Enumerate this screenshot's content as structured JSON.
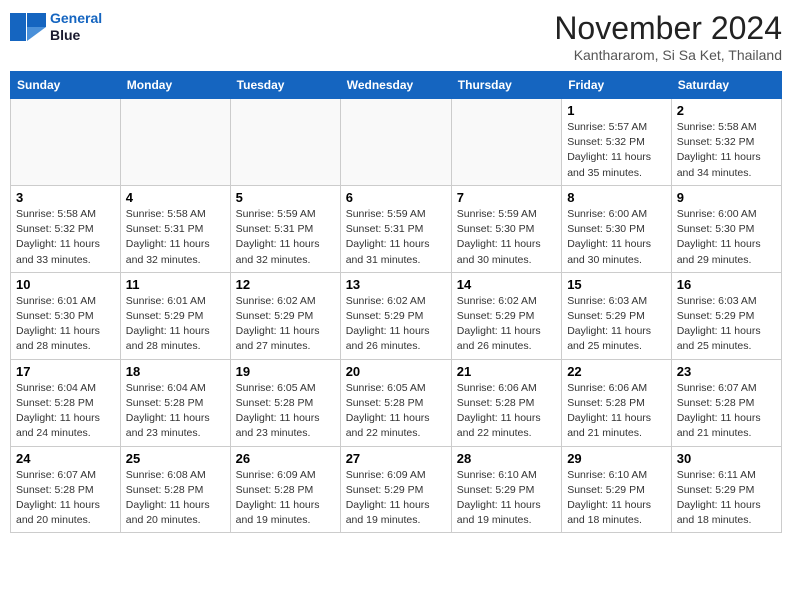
{
  "header": {
    "logo_line1": "General",
    "logo_line2": "Blue",
    "month_title": "November 2024",
    "location": "Kanthararom, Si Sa Ket, Thailand"
  },
  "weekdays": [
    "Sunday",
    "Monday",
    "Tuesday",
    "Wednesday",
    "Thursday",
    "Friday",
    "Saturday"
  ],
  "weeks": [
    [
      {
        "day": "",
        "info": ""
      },
      {
        "day": "",
        "info": ""
      },
      {
        "day": "",
        "info": ""
      },
      {
        "day": "",
        "info": ""
      },
      {
        "day": "",
        "info": ""
      },
      {
        "day": "1",
        "info": "Sunrise: 5:57 AM\nSunset: 5:32 PM\nDaylight: 11 hours and 35 minutes."
      },
      {
        "day": "2",
        "info": "Sunrise: 5:58 AM\nSunset: 5:32 PM\nDaylight: 11 hours and 34 minutes."
      }
    ],
    [
      {
        "day": "3",
        "info": "Sunrise: 5:58 AM\nSunset: 5:32 PM\nDaylight: 11 hours and 33 minutes."
      },
      {
        "day": "4",
        "info": "Sunrise: 5:58 AM\nSunset: 5:31 PM\nDaylight: 11 hours and 32 minutes."
      },
      {
        "day": "5",
        "info": "Sunrise: 5:59 AM\nSunset: 5:31 PM\nDaylight: 11 hours and 32 minutes."
      },
      {
        "day": "6",
        "info": "Sunrise: 5:59 AM\nSunset: 5:31 PM\nDaylight: 11 hours and 31 minutes."
      },
      {
        "day": "7",
        "info": "Sunrise: 5:59 AM\nSunset: 5:30 PM\nDaylight: 11 hours and 30 minutes."
      },
      {
        "day": "8",
        "info": "Sunrise: 6:00 AM\nSunset: 5:30 PM\nDaylight: 11 hours and 30 minutes."
      },
      {
        "day": "9",
        "info": "Sunrise: 6:00 AM\nSunset: 5:30 PM\nDaylight: 11 hours and 29 minutes."
      }
    ],
    [
      {
        "day": "10",
        "info": "Sunrise: 6:01 AM\nSunset: 5:30 PM\nDaylight: 11 hours and 28 minutes."
      },
      {
        "day": "11",
        "info": "Sunrise: 6:01 AM\nSunset: 5:29 PM\nDaylight: 11 hours and 28 minutes."
      },
      {
        "day": "12",
        "info": "Sunrise: 6:02 AM\nSunset: 5:29 PM\nDaylight: 11 hours and 27 minutes."
      },
      {
        "day": "13",
        "info": "Sunrise: 6:02 AM\nSunset: 5:29 PM\nDaylight: 11 hours and 26 minutes."
      },
      {
        "day": "14",
        "info": "Sunrise: 6:02 AM\nSunset: 5:29 PM\nDaylight: 11 hours and 26 minutes."
      },
      {
        "day": "15",
        "info": "Sunrise: 6:03 AM\nSunset: 5:29 PM\nDaylight: 11 hours and 25 minutes."
      },
      {
        "day": "16",
        "info": "Sunrise: 6:03 AM\nSunset: 5:29 PM\nDaylight: 11 hours and 25 minutes."
      }
    ],
    [
      {
        "day": "17",
        "info": "Sunrise: 6:04 AM\nSunset: 5:28 PM\nDaylight: 11 hours and 24 minutes."
      },
      {
        "day": "18",
        "info": "Sunrise: 6:04 AM\nSunset: 5:28 PM\nDaylight: 11 hours and 23 minutes."
      },
      {
        "day": "19",
        "info": "Sunrise: 6:05 AM\nSunset: 5:28 PM\nDaylight: 11 hours and 23 minutes."
      },
      {
        "day": "20",
        "info": "Sunrise: 6:05 AM\nSunset: 5:28 PM\nDaylight: 11 hours and 22 minutes."
      },
      {
        "day": "21",
        "info": "Sunrise: 6:06 AM\nSunset: 5:28 PM\nDaylight: 11 hours and 22 minutes."
      },
      {
        "day": "22",
        "info": "Sunrise: 6:06 AM\nSunset: 5:28 PM\nDaylight: 11 hours and 21 minutes."
      },
      {
        "day": "23",
        "info": "Sunrise: 6:07 AM\nSunset: 5:28 PM\nDaylight: 11 hours and 21 minutes."
      }
    ],
    [
      {
        "day": "24",
        "info": "Sunrise: 6:07 AM\nSunset: 5:28 PM\nDaylight: 11 hours and 20 minutes."
      },
      {
        "day": "25",
        "info": "Sunrise: 6:08 AM\nSunset: 5:28 PM\nDaylight: 11 hours and 20 minutes."
      },
      {
        "day": "26",
        "info": "Sunrise: 6:09 AM\nSunset: 5:28 PM\nDaylight: 11 hours and 19 minutes."
      },
      {
        "day": "27",
        "info": "Sunrise: 6:09 AM\nSunset: 5:29 PM\nDaylight: 11 hours and 19 minutes."
      },
      {
        "day": "28",
        "info": "Sunrise: 6:10 AM\nSunset: 5:29 PM\nDaylight: 11 hours and 19 minutes."
      },
      {
        "day": "29",
        "info": "Sunrise: 6:10 AM\nSunset: 5:29 PM\nDaylight: 11 hours and 18 minutes."
      },
      {
        "day": "30",
        "info": "Sunrise: 6:11 AM\nSunset: 5:29 PM\nDaylight: 11 hours and 18 minutes."
      }
    ]
  ]
}
